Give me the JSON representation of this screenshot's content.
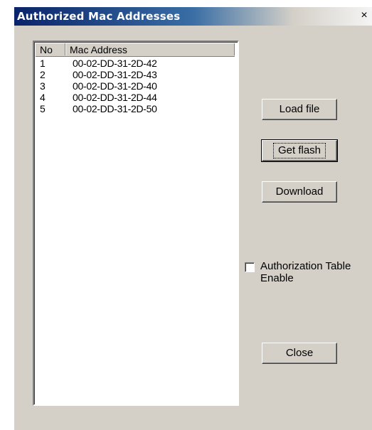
{
  "window": {
    "title": "Authorized Mac Addresses",
    "close_glyph": "×"
  },
  "list": {
    "columns": [
      "No",
      "Mac Address"
    ],
    "rows": [
      {
        "no": "1",
        "mac": "00-02-DD-31-2D-42"
      },
      {
        "no": "2",
        "mac": "00-02-DD-31-2D-43"
      },
      {
        "no": "3",
        "mac": "00-02-DD-31-2D-40"
      },
      {
        "no": "4",
        "mac": "00-02-DD-31-2D-44"
      },
      {
        "no": "5",
        "mac": "00-02-DD-31-2D-50"
      }
    ]
  },
  "buttons": {
    "load_file": "Load file",
    "get_flash": "Get flash",
    "download": "Download",
    "close": "Close"
  },
  "checkbox": {
    "label": "Authorization Table Enable",
    "checked": false
  },
  "colors": {
    "title_gradient_start": "#0a246a",
    "dialog_face": "#d4d0c8"
  }
}
